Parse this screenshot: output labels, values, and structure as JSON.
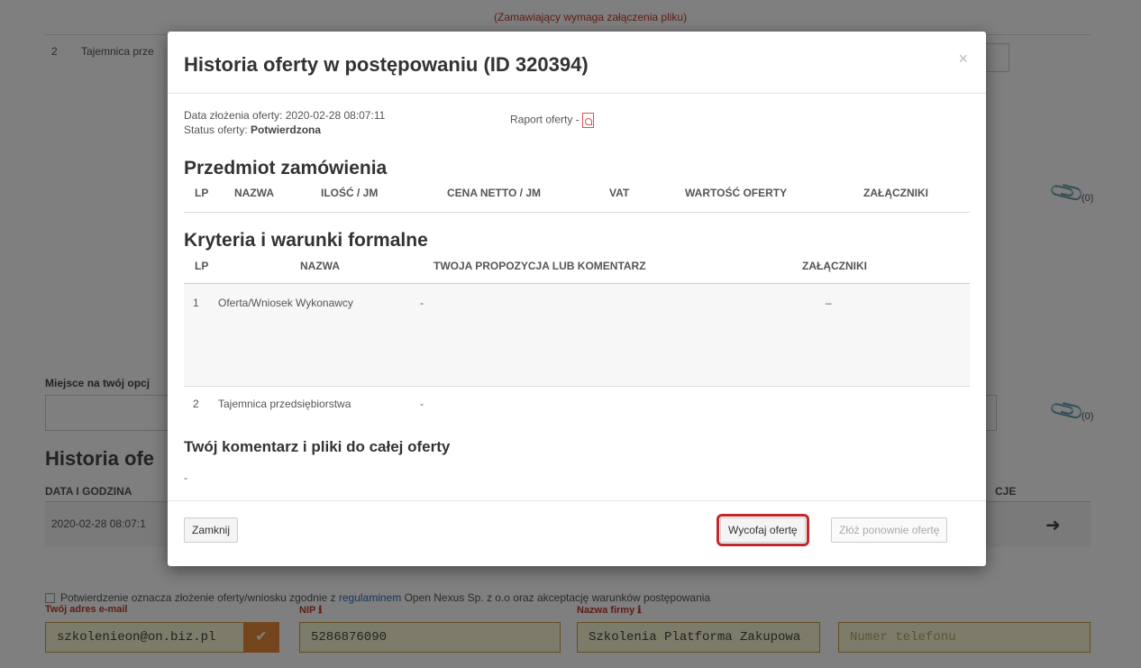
{
  "background": {
    "top_notice": "(Zamawiający wymaga załączenia pliku)",
    "row2_lp": "2",
    "row2_name": "Tajemnica prze",
    "optional_label": "Miejsce na twój opcj",
    "history_title": "Historia ofe",
    "history_col_date": "DATA I GODZINA",
    "history_col_actions": "CJE",
    "history_row_date": "2020-02-28 08:07:1",
    "attachments_count_1": "(0)",
    "attachments_count_2": "(0)",
    "terms_prefix": "Potwierdzenie oznacza złożenie oferty/wniosku zgodnie z",
    "terms_link": "regulaminem",
    "terms_suffix": "Open Nexus Sp. z o.o oraz akceptację warunków postępowania",
    "email_label": "Twój adres e-mail",
    "email_value": "szkolenieon@on.biz.pl",
    "nip_label": "NIP",
    "nip_value": "5286876090",
    "company_label": "Nazwa firmy",
    "company_value": "Szkolenia Platforma Zakupowa",
    "phone_placeholder": "Numer telefonu"
  },
  "modal": {
    "title": "Historia oferty w postępowaniu (ID 320394)",
    "close_symbol": "×",
    "submitted_label": "Data złożenia oferty:",
    "submitted_value": "2020-02-28 08:07:11",
    "status_label": "Status oferty:",
    "status_value": "Potwierdzona",
    "report_label": "Raport oferty -",
    "subject_heading": "Przedmiot zamówienia",
    "subject_columns": [
      "LP",
      "NAZWA",
      "ILOŚĆ / JM",
      "CENA NETTO / JM",
      "VAT",
      "WARTOŚĆ OFERTY",
      "ZAŁĄCZNIKI"
    ],
    "criteria_heading": "Kryteria i warunki formalne",
    "criteria_columns": [
      "LP",
      "NAZWA",
      "TWOJA PROPOZYCJA LUB KOMENTARZ",
      "ZAŁĄCZNIKI"
    ],
    "criteria_rows": [
      {
        "lp": "1",
        "name": "Oferta/Wniosek Wykonawcy",
        "comment": "-",
        "attachments": "–"
      },
      {
        "lp": "2",
        "name": "Tajemnica przedsiębiorstwa",
        "comment": "-",
        "attachments": ""
      }
    ],
    "comment_heading": "Twój komentarz i pliki do całej oferty",
    "comment_value": "-",
    "close_button": "Zamknij",
    "withdraw_button": "Wycofaj ofertę",
    "resubmit_button": "Złóż ponownie ofertę"
  }
}
